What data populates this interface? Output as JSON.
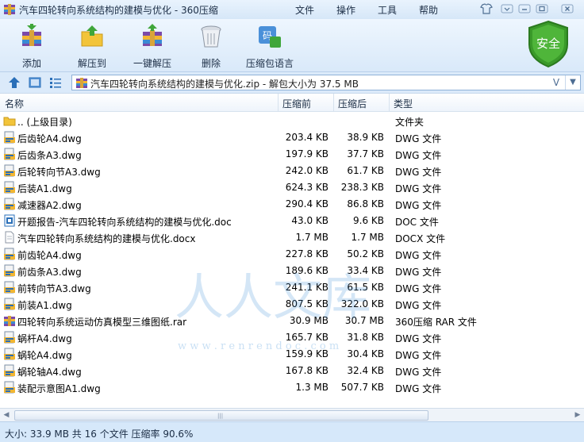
{
  "window": {
    "title": "汽车四轮转向系统结构的建模与优化 - 360压缩",
    "menu": [
      "文件",
      "操作",
      "工具",
      "帮助"
    ]
  },
  "toolbar": {
    "buttons": [
      {
        "label": "添加",
        "icon": "add-archive-icon"
      },
      {
        "label": "解压到",
        "icon": "extract-to-icon"
      },
      {
        "label": "一键解压",
        "icon": "one-click-extract-icon"
      },
      {
        "label": "删除",
        "icon": "delete-trash-icon"
      },
      {
        "label": "压缩包语言",
        "icon": "archive-language-icon"
      }
    ],
    "security_label": "安全"
  },
  "addressbar": {
    "path": "汽车四轮转向系统结构的建模与优化.zip - 解包大小为 37.5 MB",
    "dropdown_glyph": "V"
  },
  "columns": [
    "名称",
    "压缩前",
    "压缩后",
    "类型"
  ],
  "files": [
    {
      "name": ".. (上级目录)",
      "size": "",
      "packed": "",
      "type": "文件夹",
      "icon": "folder"
    },
    {
      "name": "后齿轮A4.dwg",
      "size": "203.4 KB",
      "packed": "38.9 KB",
      "type": "DWG 文件",
      "icon": "dwg"
    },
    {
      "name": "后齿条A3.dwg",
      "size": "197.9 KB",
      "packed": "37.7 KB",
      "type": "DWG 文件",
      "icon": "dwg"
    },
    {
      "name": "后轮转向节A3.dwg",
      "size": "242.0 KB",
      "packed": "61.7 KB",
      "type": "DWG 文件",
      "icon": "dwg"
    },
    {
      "name": "后装A1.dwg",
      "size": "624.3 KB",
      "packed": "238.3 KB",
      "type": "DWG 文件",
      "icon": "dwg"
    },
    {
      "name": "减速器A2.dwg",
      "size": "290.4 KB",
      "packed": "86.8 KB",
      "type": "DWG 文件",
      "icon": "dwg"
    },
    {
      "name": "开题报告-汽车四轮转向系统结构的建模与优化.doc",
      "size": "43.0 KB",
      "packed": "9.6 KB",
      "type": "DOC 文件",
      "icon": "doc"
    },
    {
      "name": "汽车四轮转向系统结构的建模与优化.docx",
      "size": "1.7 MB",
      "packed": "1.7 MB",
      "type": "DOCX 文件",
      "icon": "docx"
    },
    {
      "name": "前齿轮A4.dwg",
      "size": "227.8 KB",
      "packed": "50.2 KB",
      "type": "DWG 文件",
      "icon": "dwg"
    },
    {
      "name": "前齿条A3.dwg",
      "size": "189.6 KB",
      "packed": "33.4 KB",
      "type": "DWG 文件",
      "icon": "dwg"
    },
    {
      "name": "前转向节A3.dwg",
      "size": "241.1 KB",
      "packed": "61.5 KB",
      "type": "DWG 文件",
      "icon": "dwg"
    },
    {
      "name": "前装A1.dwg",
      "size": "807.5 KB",
      "packed": "322.0 KB",
      "type": "DWG 文件",
      "icon": "dwg"
    },
    {
      "name": "四轮转向系统运动仿真模型三维图纸.rar",
      "size": "30.9 MB",
      "packed": "30.7 MB",
      "type": "360压缩 RAR 文件",
      "icon": "rar"
    },
    {
      "name": "蜗杆A4.dwg",
      "size": "165.7 KB",
      "packed": "31.8 KB",
      "type": "DWG 文件",
      "icon": "dwg"
    },
    {
      "name": "蜗轮A4.dwg",
      "size": "159.9 KB",
      "packed": "30.4 KB",
      "type": "DWG 文件",
      "icon": "dwg"
    },
    {
      "name": "蜗轮轴A4.dwg",
      "size": "167.8 KB",
      "packed": "32.4 KB",
      "type": "DWG 文件",
      "icon": "dwg"
    },
    {
      "name": "装配示意图A1.dwg",
      "size": "1.3 MB",
      "packed": "507.7 KB",
      "type": "DWG 文件",
      "icon": "dwg"
    }
  ],
  "watermark": {
    "site": "w w w . r e n r e n d o c . c o m"
  },
  "status": {
    "text": "大小: 33.9 MB 共 16 个文件 压缩率 90.6%"
  },
  "colors": {
    "accent": "#2a6fb8",
    "titlebar": "#dcebfa",
    "security_green": "#3a9a2a"
  }
}
